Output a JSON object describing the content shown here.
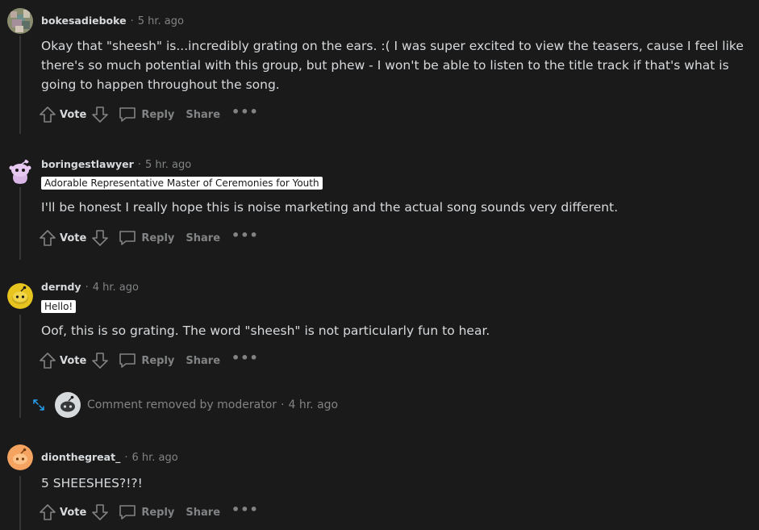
{
  "comments": [
    {
      "username": "bokesadieboke",
      "time": "5 hr. ago",
      "flair": "",
      "body": "Okay that \"sheesh\" is...incredibly grating on the ears. :( I was super excited to view the teasers, cause I feel like there's so much potential with this group, but phew - I won't be able to listen to the title track if that's what is going to happen throughout the song.",
      "avatar_icon": "pixel-avatar-icon"
    },
    {
      "username": "boringestlawyer",
      "time": "5 hr. ago",
      "flair": "Adorable Representative Master of Ceremonies for Youth",
      "body": "I'll be honest I really hope this is noise marketing and the actual song sounds very different.",
      "avatar_icon": "snoo-pink-avatar-icon"
    },
    {
      "username": "derndy",
      "time": "4 hr. ago",
      "flair": "Hello!",
      "body": "Oof, this is so grating. The word \"sheesh\" is not particularly fun to hear.",
      "avatar_icon": "snoo-yellow-avatar-icon"
    },
    {
      "username": "dionthegreat_",
      "time": "6 hr. ago",
      "flair": "",
      "body": "5 SHEESHES?!?!",
      "avatar_icon": "snoo-orange-avatar-icon"
    }
  ],
  "actions": {
    "vote_label": "Vote",
    "reply_label": "Reply",
    "share_label": "Share",
    "more_label": "•••"
  },
  "removed_comment": {
    "text": "Comment removed by moderator",
    "time": "4 hr. ago"
  },
  "colors": {
    "background": "#1a1a1b",
    "text": "#d7dadc",
    "muted": "#818384",
    "thread_line": "#343536",
    "flair_bg": "#ffffff",
    "expand_icon": "#24a0ed"
  }
}
